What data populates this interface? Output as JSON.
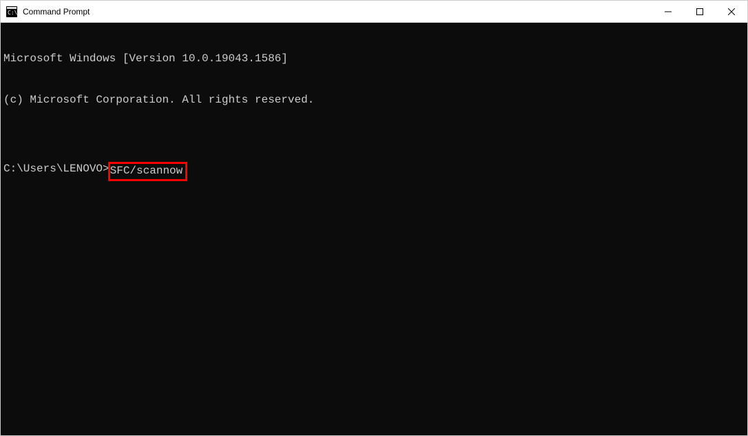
{
  "window": {
    "title": "Command Prompt"
  },
  "console": {
    "line1": "Microsoft Windows [Version 10.0.19043.1586]",
    "line2": "(c) Microsoft Corporation. All rights reserved.",
    "blank": "",
    "prompt": "C:\\Users\\LENOVO>",
    "command": "SFC/scannow"
  }
}
